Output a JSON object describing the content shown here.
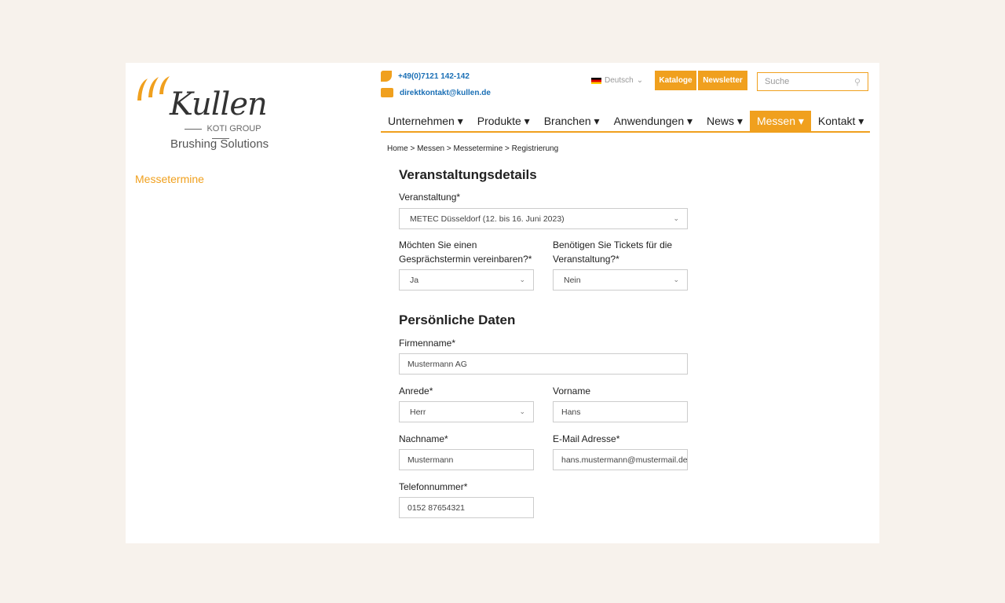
{
  "brand": {
    "name": "Kullen",
    "group": "KOTI GROUP",
    "tagline": "Brushing Solutions"
  },
  "sidebar": {
    "item": "Messetermine"
  },
  "contact": {
    "phone": "+49(0)7121 142-142",
    "email": "direktkontakt@kullen.de"
  },
  "language": "Deutsch",
  "buttons": {
    "catalogs": "Kataloge",
    "newsletter": "Newsletter"
  },
  "search": {
    "placeholder": "Suche"
  },
  "nav": [
    "Unternehmen",
    "Produkte",
    "Branchen",
    "Anwendungen",
    "News",
    "Messen",
    "Kontakt"
  ],
  "breadcrumb": "Home >  Messen >  Messetermine >  Registrierung",
  "event": {
    "title": "Veranstaltungsdetails",
    "event_label": "Veranstaltung*",
    "event_value": "METEC Düsseldorf (12. bis 16. Juni 2023)",
    "meeting_label": "Möchten Sie einen Gesprächstermin vereinbaren?*",
    "meeting_value": "Ja",
    "tickets_label": "Benötigen Sie Tickets für die Veranstaltung?*",
    "tickets_value": "Nein"
  },
  "personal": {
    "title": "Persönliche Daten",
    "company_label": "Firmenname*",
    "company_value": "Mustermann AG",
    "salutation_label": "Anrede*",
    "salutation_value": "Herr",
    "first_label": "Vorname",
    "first_value": "Hans",
    "last_label": "Nachname*",
    "last_value": "Mustermann",
    "email_label": "E-Mail Adresse*",
    "email_value": "hans.mustermann@mustermail.de",
    "phone_label": "Telefonnummer*",
    "phone_value": "0152 87654321"
  },
  "colors": {
    "accent": "#f0a01e",
    "link": "#1a6fb5"
  }
}
